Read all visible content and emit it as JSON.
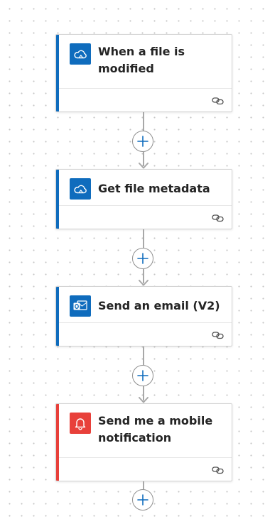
{
  "colors": {
    "onedrive_blue": "#0f6cbd",
    "outlook_blue": "#0f6cbd",
    "notification_red": "#e8403a",
    "accent_blue": "#0f6cbd",
    "accent_red": "#e8403a",
    "connector_gray": "#a8a8a8",
    "plus_blue": "#0f6cbd"
  },
  "flow": {
    "steps": [
      {
        "title": "When a file is modified",
        "icon": "onedrive-cloud-icon",
        "footer_icon": "link-icon"
      },
      {
        "title": "Get file metadata",
        "icon": "onedrive-cloud-icon",
        "footer_icon": "link-icon"
      },
      {
        "title": "Send an email (V2)",
        "icon": "outlook-icon",
        "footer_icon": "link-icon"
      },
      {
        "title": "Send me a mobile notification",
        "icon": "bell-icon",
        "footer_icon": "link-icon"
      }
    ],
    "insert_buttons": [
      "plus-icon",
      "plus-icon",
      "plus-icon",
      "plus-icon"
    ]
  }
}
